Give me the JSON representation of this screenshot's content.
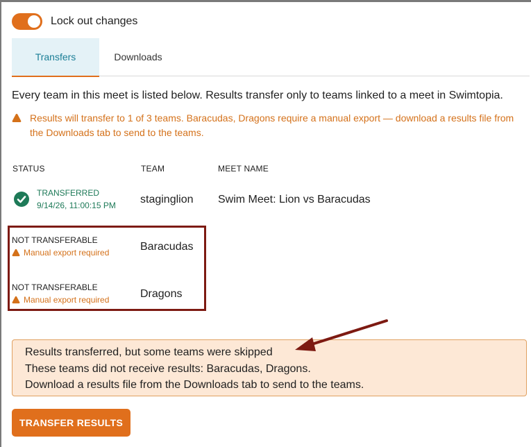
{
  "toggle": {
    "label": "Lock out changes",
    "on": true
  },
  "tabs": [
    {
      "label": "Transfers",
      "active": true
    },
    {
      "label": "Downloads",
      "active": false
    }
  ],
  "intro": "Every team in this meet is listed below. Results transfer only to teams linked to a meet in Swimtopia.",
  "warning": {
    "line1": "Results will transfer to 1 of 3 teams. Baracudas, Dragons require a manual export — download a results file from",
    "line2": "the Downloads tab to send to the teams."
  },
  "table": {
    "headers": {
      "status": "STATUS",
      "team": "TEAM",
      "meet": "MEET NAME"
    },
    "rows": [
      {
        "status": "TRANSFERRED",
        "status_sub": "9/14/26, 11:00:15 PM",
        "team": "staginglion",
        "meet": "Swim Meet: Lion vs Baracudas"
      },
      {
        "status": "NOT TRANSFERABLE",
        "status_sub": "Manual export required",
        "team": "Baracudas",
        "meet": ""
      },
      {
        "status": "NOT TRANSFERABLE",
        "status_sub": "Manual export required",
        "team": "Dragons",
        "meet": ""
      }
    ]
  },
  "banner": {
    "title": "Results transferred, but some teams were skipped",
    "line2": "These teams did not receive results: Baracudas, Dragons.",
    "line3": "Download a results file from the Downloads tab to send to the teams."
  },
  "button": {
    "label": "TRANSFER RESULTS"
  },
  "colors": {
    "accent": "#e06f1c",
    "success": "#1e7a58",
    "warning": "#d4711a",
    "annotation": "#7d1a12"
  },
  "icons": {
    "warning": "warning-triangle-icon",
    "success": "check-circle-icon"
  }
}
